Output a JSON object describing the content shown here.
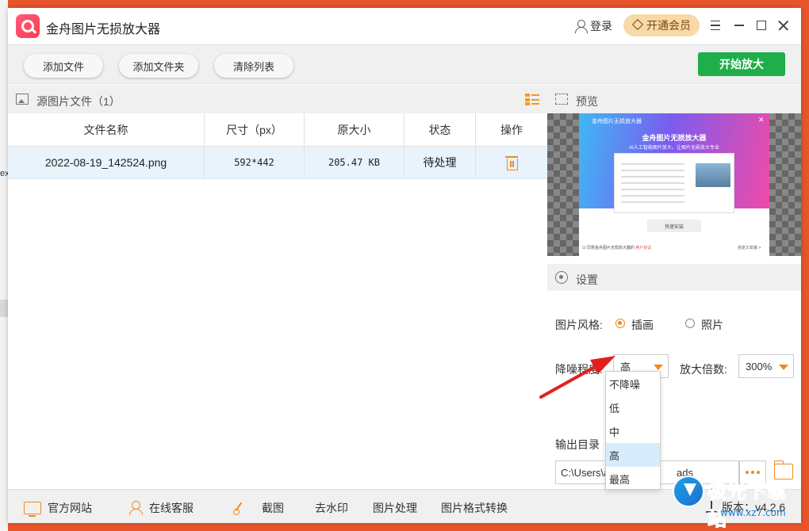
{
  "app": {
    "title": "金舟图片无损放大器",
    "login_label": "登录",
    "vip_label": "开通会员"
  },
  "desktop": {
    "fragment_text": "ex"
  },
  "toolbar": {
    "add_file": "添加文件",
    "add_folder": "添加文件夹",
    "clear_list": "清除列表",
    "start": "开始放大"
  },
  "source": {
    "title": "源图片文件（1）",
    "columns": [
      "文件名称",
      "尺寸（px）",
      "原大小",
      "状态",
      "操作"
    ],
    "rows": [
      {
        "name": "2022-08-19_142524.png",
        "size": "592*442",
        "orig_size": "205.47 KB",
        "status": "待处理"
      }
    ]
  },
  "preview": {
    "title": "预览",
    "thumb": {
      "app_title": "金舟图片无损放大器",
      "heading": "金舟图片无损放大器",
      "subheading": "AI人工智能图片放大，让图片无损放大专业",
      "install_label": "快速安装",
      "agree_text": "同意金舟图片无损放大器的",
      "agree_link": "用户协议",
      "custom_install": "自定义安装 >"
    }
  },
  "settings": {
    "title": "设置",
    "style_label": "图片风格:",
    "style_options": [
      "插画",
      "照片"
    ],
    "style_selected": "插画",
    "denoise_label": "降噪程度:",
    "denoise_value": "高",
    "denoise_options": [
      "不降噪",
      "低",
      "中",
      "高",
      "最高"
    ],
    "scale_label": "放大倍数:",
    "scale_value": "300%",
    "output_label": "输出目录",
    "output_path": "C:\\Users\\ad",
    "output_path_tail": "ads"
  },
  "footer": {
    "items": [
      "官方网站",
      "在线客服",
      "截图",
      "去水印",
      "图片处理",
      "图片格式转换"
    ],
    "version": "版本：v4.2.6"
  },
  "watermark": {
    "text": "极光下载站",
    "url": "www.xz7.com"
  },
  "colors": {
    "accent": "#f08a1c",
    "start_green": "#1fae4b",
    "desktop_bg": "#e9552b",
    "arrow_red": "#e02020"
  }
}
